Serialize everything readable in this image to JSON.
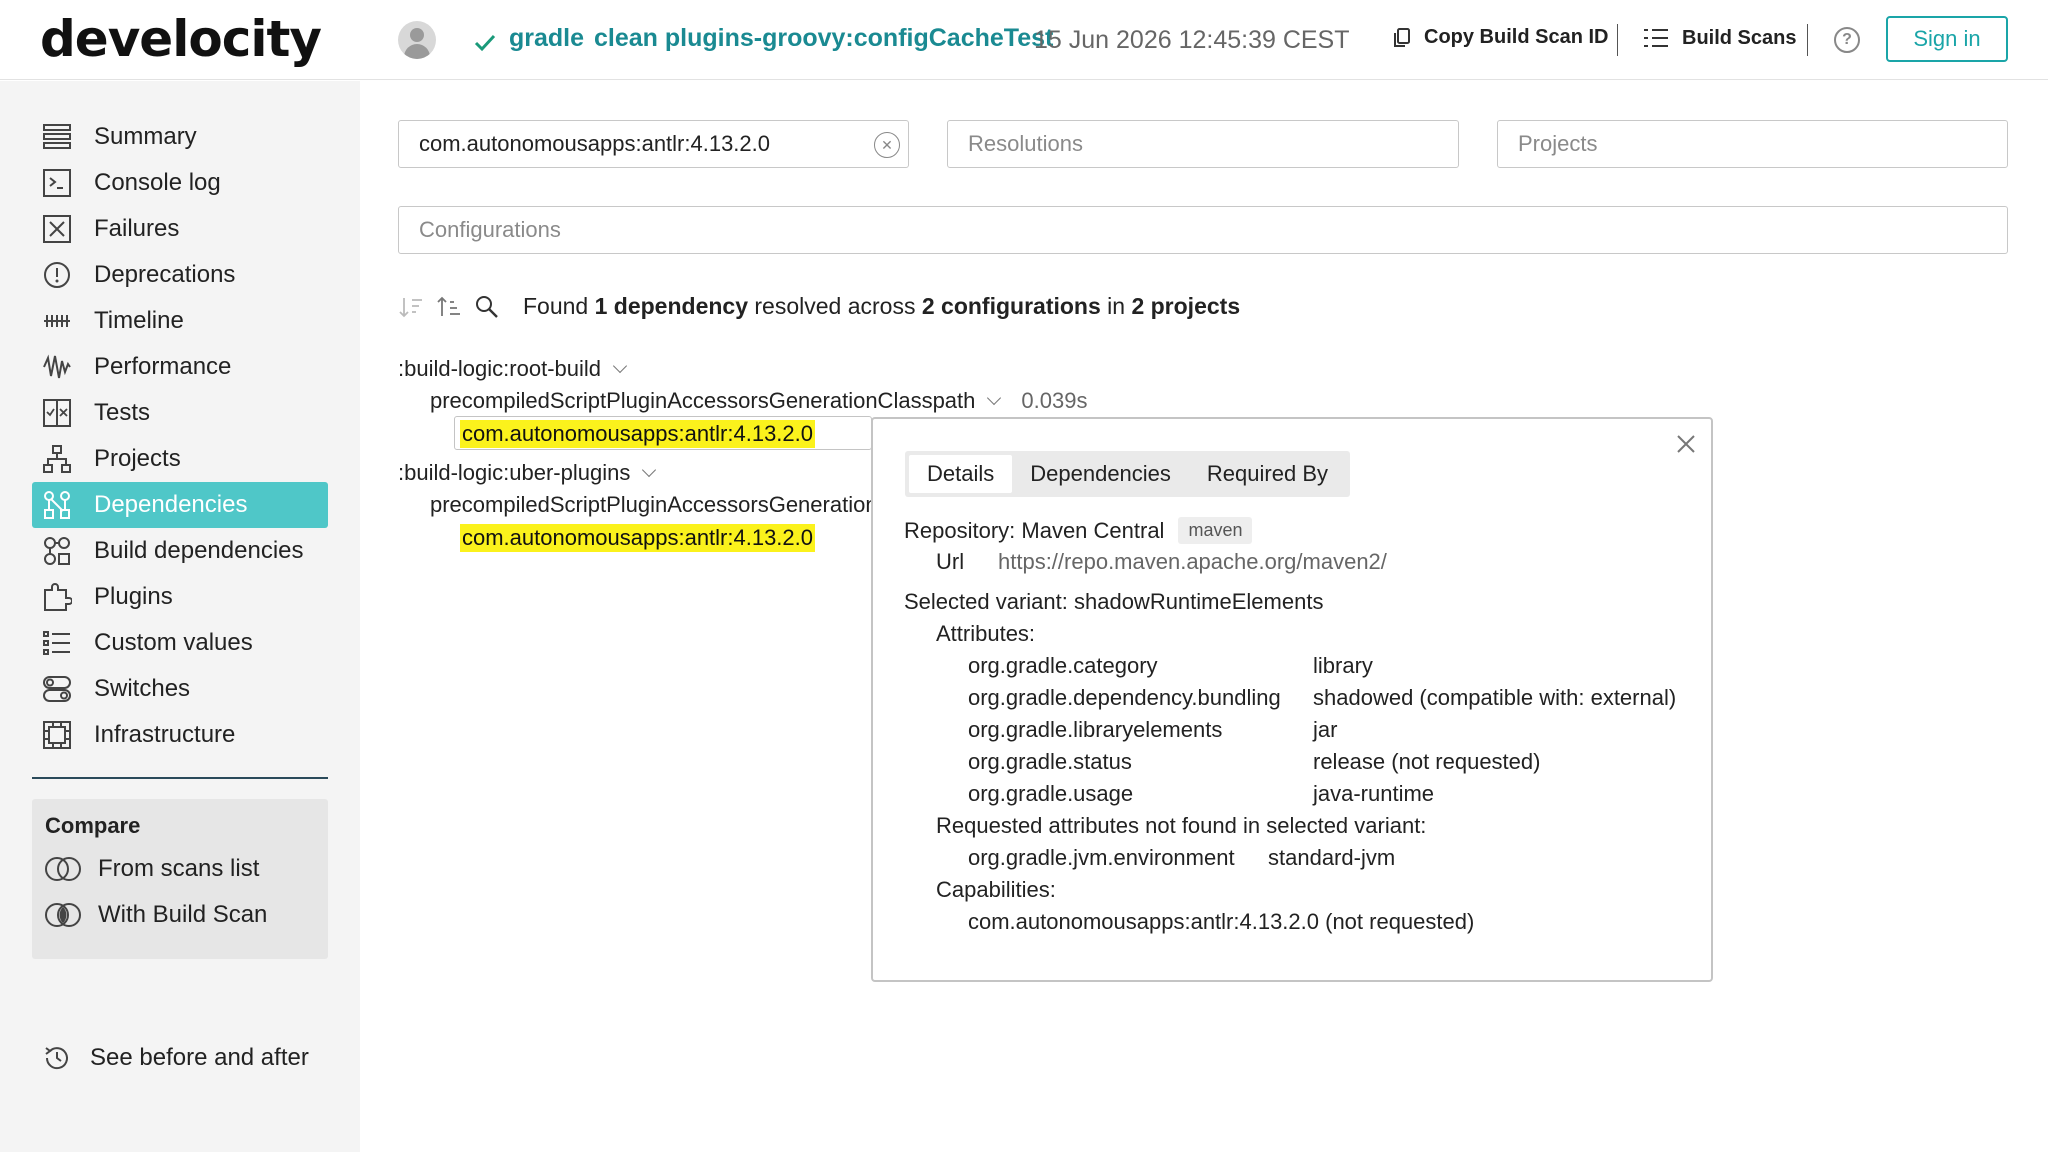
{
  "header": {
    "logo": "develocity",
    "project": "gradle",
    "task": "clean plugins-groovy:configCacheTest",
    "date": "15 Jun 2026 12:45:39 CEST",
    "copy_label": "Copy Build Scan ID",
    "scans_label": "Build Scans",
    "help": "?",
    "signin_label": "Sign in"
  },
  "sidebar": {
    "items": [
      {
        "label": "Summary",
        "icon": "summary-icon"
      },
      {
        "label": "Console log",
        "icon": "console-icon"
      },
      {
        "label": "Failures",
        "icon": "failures-icon"
      },
      {
        "label": "Deprecations",
        "icon": "deprecations-icon"
      },
      {
        "label": "Timeline",
        "icon": "timeline-icon"
      },
      {
        "label": "Performance",
        "icon": "performance-icon"
      },
      {
        "label": "Tests",
        "icon": "tests-icon"
      },
      {
        "label": "Projects",
        "icon": "projects-icon"
      },
      {
        "label": "Dependencies",
        "icon": "dependencies-icon",
        "active": true
      },
      {
        "label": "Build dependencies",
        "icon": "build-dependencies-icon"
      },
      {
        "label": "Plugins",
        "icon": "plugins-icon"
      },
      {
        "label": "Custom values",
        "icon": "custom-values-icon"
      },
      {
        "label": "Switches",
        "icon": "switches-icon"
      },
      {
        "label": "Infrastructure",
        "icon": "infrastructure-icon"
      }
    ],
    "compare_title": "Compare",
    "compare_from": "From scans list",
    "compare_with": "With Build Scan",
    "before_after": "See before and after"
  },
  "filters": {
    "dependency_value": "com.autonomousapps:antlr:4.13.2.0",
    "resolutions_placeholder": "Resolutions",
    "projects_placeholder": "Projects",
    "configurations_placeholder": "Configurations"
  },
  "summary": {
    "prefix": "Found ",
    "count": "1 dependency",
    "mid1": " resolved across ",
    "configs": "2 configurations",
    "mid2": " in ",
    "projects": "2 projects"
  },
  "tree": {
    "project1": ":build-logic:root-build",
    "config1": "precompiledScriptPluginAccessorsGenerationClasspath",
    "config1_time": "0.039s",
    "dep1": "com.autonomousapps:antlr:4.13.2.0",
    "project2": ":build-logic:uber-plugins",
    "config2": "precompiledScriptPluginAccessorsGeneration",
    "dep2": "com.autonomousapps:antlr:4.13.2.0"
  },
  "popup": {
    "tabs": [
      "Details",
      "Dependencies",
      "Required By"
    ],
    "repository": "Repository: Maven Central",
    "repo_badge": "maven",
    "url_label": "Url",
    "url_value": "https://repo.maven.apache.org/maven2/",
    "variant": "Selected variant: shadowRuntimeElements",
    "attributes_title": "Attributes:",
    "attributes": [
      {
        "key": "org.gradle.category",
        "value": "library"
      },
      {
        "key": "org.gradle.dependency.bundling",
        "value": "shadowed (compatible with: external)"
      },
      {
        "key": "org.gradle.libraryelements",
        "value": "jar"
      },
      {
        "key": "org.gradle.status",
        "value": "release (not requested)"
      },
      {
        "key": "org.gradle.usage",
        "value": "java-runtime"
      }
    ],
    "requested_title": "Requested attributes not found in selected variant:",
    "requested_key": "org.gradle.jvm.environment",
    "requested_value": "standard-jvm",
    "capabilities_title": "Capabilities:",
    "capability": "com.autonomousapps:antlr:4.13.2.0 (not requested)"
  },
  "colors": {
    "accent": "#1aa5a8",
    "active_nav": "#4fc7c8",
    "highlight": "#fbf21c",
    "brand_text": "#1a8a92"
  }
}
